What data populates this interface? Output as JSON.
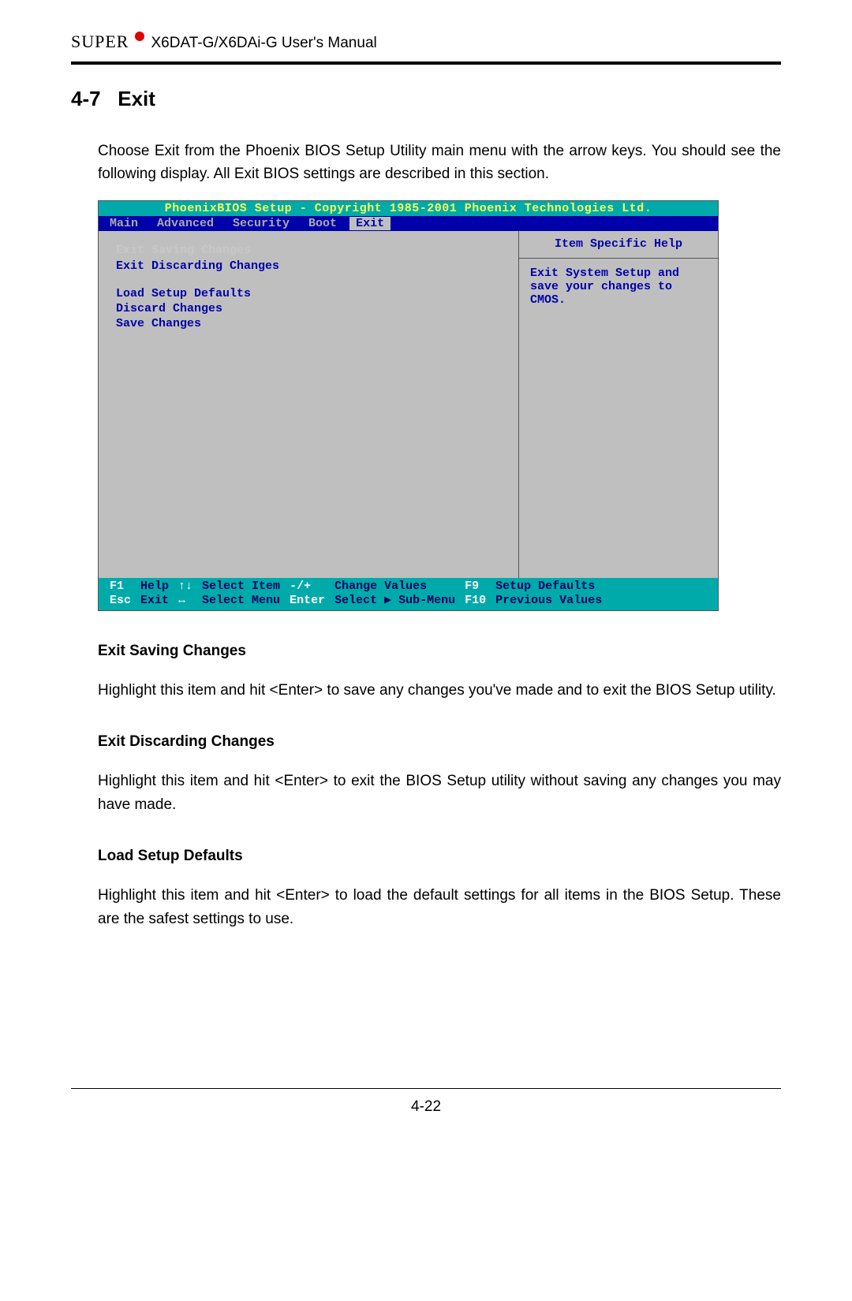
{
  "header": {
    "brand": "SUPER",
    "manual": "X6DAT-G/X6DAi-G User's Manual"
  },
  "section_number": "4-7",
  "section_name": "Exit",
  "intro": "Choose Exit from the Phoenix BIOS Setup Utility main menu with the arrow keys. You should see the following display.  All Exit BIOS settings are described in this section.",
  "bios": {
    "title": "PhoenixBIOS Setup - Copyright 1985-2001 Phoenix Technologies Ltd.",
    "tabs": [
      "Main",
      "Advanced",
      "Security",
      "Boot",
      "Exit"
    ],
    "active_tab_index": 4,
    "menu_items": [
      "Exit Saving Changes",
      "Exit Discarding Changes",
      "Load Setup Defaults",
      "Discard Changes",
      "Save Changes"
    ],
    "selected_index": 0,
    "help_title": "Item Specific Help",
    "help_text": "Exit System Setup and save your changes to CMOS.",
    "footer": {
      "r1": {
        "k1": "F1",
        "d1": "Help",
        "k2": "↑↓",
        "d2": "Select Item",
        "k3": "-/+",
        "d3": "Change Values",
        "k4": "F9",
        "d4": "Setup Defaults"
      },
      "r2": {
        "k1": "Esc",
        "d1": "Exit",
        "k2": "↔",
        "d2": "Select Menu",
        "k3": "Enter",
        "d3": "Select ▶ Sub-Menu",
        "k4": "F10",
        "d4": "Previous Values"
      }
    }
  },
  "subs": [
    {
      "title": "Exit Saving Changes",
      "body": "Highlight this item and hit <Enter> to save any changes you've made and to exit the BIOS Setup utility."
    },
    {
      "title": "Exit Discarding Changes",
      "body": "Highlight this item and hit <Enter> to exit the BIOS Setup utility without saving any changes you may have made."
    },
    {
      "title": "Load Setup Defaults",
      "body": "Highlight this item and hit <Enter> to load the default settings for all items in the BIOS Setup.  These are the safest settings to use."
    }
  ],
  "page_number": "4-22"
}
